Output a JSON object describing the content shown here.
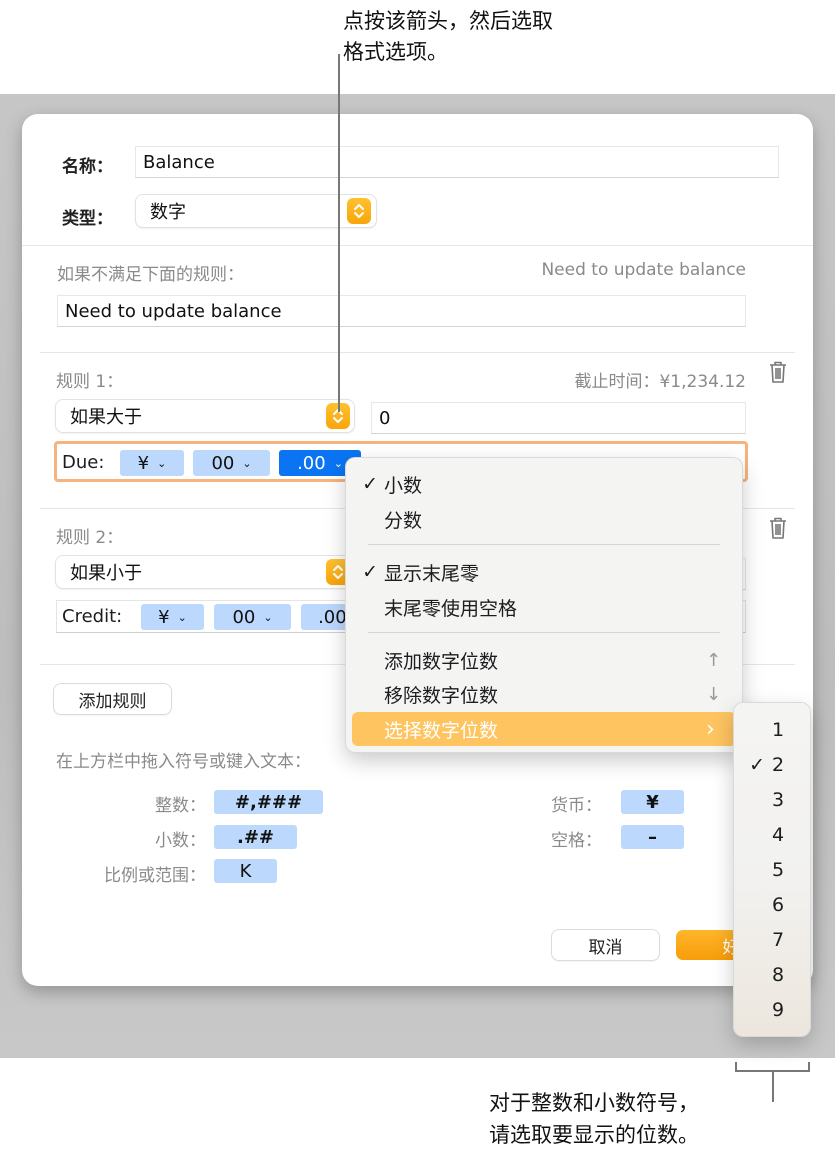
{
  "annotations": {
    "top_line1": "点按该箭头，然后选取",
    "top_line2": "格式选项。",
    "bottom_line1": "对于整数和小数符号，",
    "bottom_line2": "请选取要显示的位数。"
  },
  "dialog": {
    "name_label": "名称：",
    "name_value": "Balance",
    "type_label": "类型：",
    "type_value": "数字",
    "fallback_label": "如果不满足下面的规则：",
    "fallback_preview": "Need to update balance",
    "fallback_value": "Need to update balance",
    "rules": [
      {
        "title": "规则 1：",
        "preview": "截止时间：¥1,234.12",
        "condition": "如果大于",
        "value": "0",
        "format_prefix": "Due:",
        "tokens": [
          "¥",
          "00",
          ".00"
        ]
      },
      {
        "title": "规则 2：",
        "condition": "如果小于",
        "format_prefix": "Credit:",
        "tokens": [
          "¥",
          "00",
          ".00"
        ]
      }
    ],
    "add_rule": "添加规则",
    "hint": "在上方栏中拖入符号或键入文本：",
    "symbols": [
      {
        "label": "整数：",
        "token": "#,###"
      },
      {
        "label": "小数：",
        "token": ".##"
      },
      {
        "label": "比例或范围：",
        "token": "K"
      },
      {
        "label": "货币：",
        "token": "¥"
      },
      {
        "label": "空格：",
        "token": "–"
      }
    ],
    "cancel": "取消",
    "ok": "好"
  },
  "menu": {
    "items": [
      {
        "label": "小数",
        "checked": true
      },
      {
        "label": "分数",
        "checked": false
      },
      {
        "label": "显示末尾零",
        "checked": true
      },
      {
        "label": "末尾零使用空格",
        "checked": false
      },
      {
        "label": "添加数字位数",
        "shortcut": "↑"
      },
      {
        "label": "移除数字位数",
        "shortcut": "↓"
      },
      {
        "label": "选择数字位数",
        "submenu_arrow": "›",
        "highlighted": true
      }
    ],
    "check_glyph": "✓"
  },
  "submenu": {
    "items": [
      "1",
      "2",
      "3",
      "4",
      "5",
      "6",
      "7",
      "8",
      "9"
    ],
    "selected": "2"
  },
  "colors": {
    "accent_orange": "#f9a50a",
    "highlight": "#fec460",
    "token_blue": "#bcd8fd",
    "token_selected": "#0a74f2"
  }
}
